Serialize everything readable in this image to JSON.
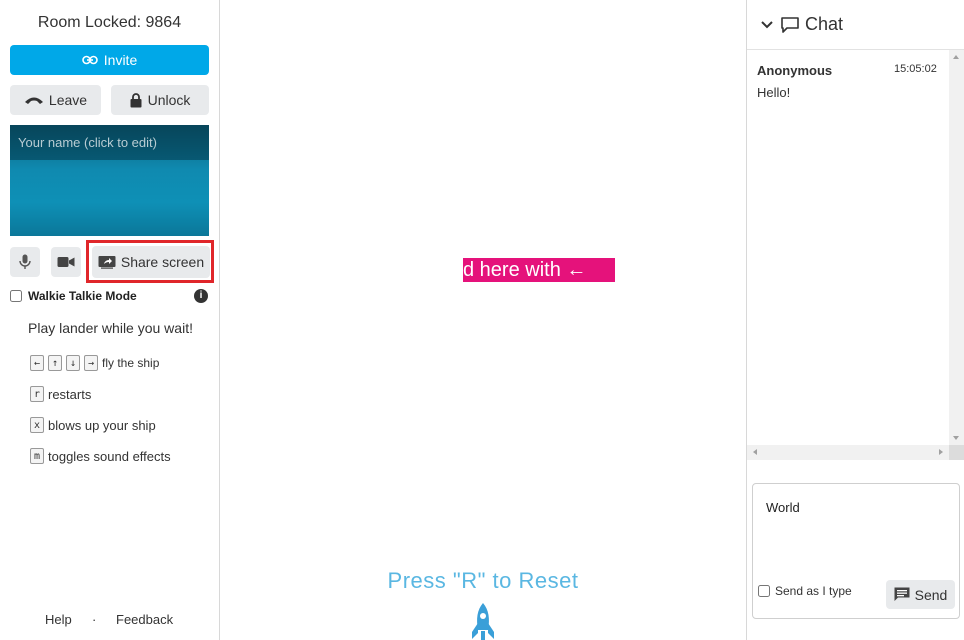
{
  "sidebar": {
    "room_title": "Room Locked: 9864",
    "invite_label": "Invite",
    "leave_label": "Leave",
    "unlock_label": "Unlock",
    "name_placeholder": "Your name (click to edit)",
    "share_label": "Share screen",
    "walkie_label": "Walkie Talkie Mode",
    "info_glyph": "i",
    "play_text": "Play lander while you wait!",
    "controls": [
      {
        "keys": [
          "←",
          "↑",
          "↓",
          "→"
        ],
        "desc": "fly the ship"
      },
      {
        "keys": [
          "r"
        ],
        "desc": "restarts"
      },
      {
        "keys": [
          "x"
        ],
        "desc": "blows up your ship"
      },
      {
        "keys": [
          "m"
        ],
        "desc": "toggles sound effects"
      }
    ],
    "footer": {
      "help": "Help",
      "separator": "·",
      "feedback": "Feedback"
    }
  },
  "main": {
    "marquee_text": "d here with ←",
    "press_reset": "Press \"R\" to Reset",
    "accent_color": "#e5127b",
    "rocket_color": "#3a9fd8"
  },
  "chat": {
    "title": "Chat",
    "messages": [
      {
        "author": "Anonymous",
        "time": "15:05:02",
        "text": "Hello!"
      }
    ],
    "input_value": "World",
    "send_as_label": "Send as I type",
    "send_label": "Send"
  },
  "colors": {
    "primary": "#00a8e8",
    "highlight": "#e0262a"
  }
}
